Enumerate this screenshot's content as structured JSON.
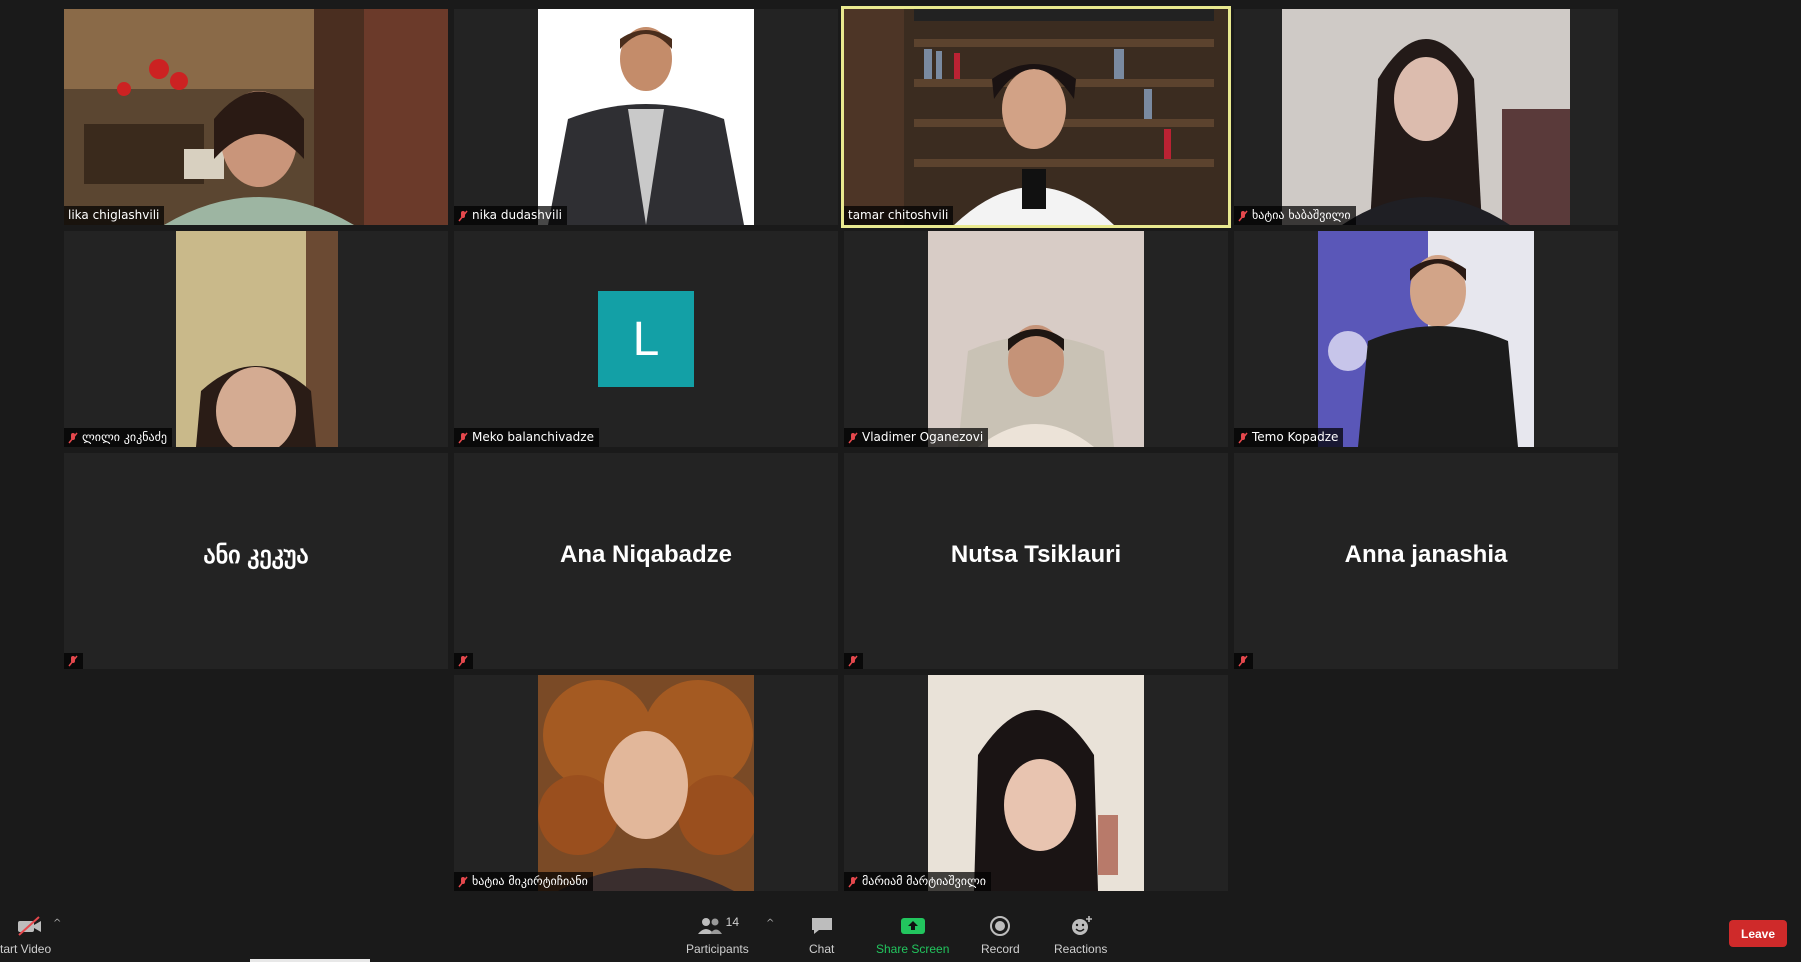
{
  "participants": [
    {
      "name": "lika chiglashvili",
      "muted": false,
      "active": false,
      "kind": "video",
      "scene": "living-room"
    },
    {
      "name": "nika dudashvili",
      "muted": true,
      "active": false,
      "kind": "photo",
      "scene": "suit-white"
    },
    {
      "name": "tamar chitoshvili",
      "muted": false,
      "active": true,
      "kind": "video",
      "scene": "bookshelf"
    },
    {
      "name": "ხატია ხაბაშვილი",
      "muted": true,
      "active": false,
      "kind": "photo",
      "scene": "dark-hair"
    },
    {
      "name": "ლილი კიკნაძე",
      "muted": true,
      "active": false,
      "kind": "photo",
      "scene": "wallpaper"
    },
    {
      "name": "Meko balanchivadze",
      "muted": true,
      "active": false,
      "kind": "avatar",
      "initial": "L"
    },
    {
      "name": "Vladimer Oganezovi",
      "muted": true,
      "active": false,
      "kind": "photo",
      "scene": "chair"
    },
    {
      "name": "Temo Kopadze",
      "muted": true,
      "active": false,
      "kind": "photo",
      "scene": "banner"
    },
    {
      "name": "",
      "big_name": "ანი კეკუა",
      "muted": true,
      "active": false,
      "kind": "name"
    },
    {
      "name": "",
      "big_name": "Ana Niqabadze",
      "muted": true,
      "active": false,
      "kind": "name"
    },
    {
      "name": "",
      "big_name": "Nutsa Tsiklauri",
      "muted": true,
      "active": false,
      "kind": "name"
    },
    {
      "name": "",
      "big_name": "Anna janashia",
      "muted": true,
      "active": false,
      "kind": "name"
    },
    {
      "name": "ხატია მიკირტიჩიანი",
      "muted": true,
      "active": false,
      "kind": "photo",
      "scene": "curly"
    },
    {
      "name": "მარიამ მარტიაშვილი",
      "muted": true,
      "active": false,
      "kind": "photo",
      "scene": "white-wall"
    }
  ],
  "toolbar": {
    "start_video_label": "tart Video",
    "participants_label": "Participants",
    "participants_count": "14",
    "chat_label": "Chat",
    "share_label": "Share Screen",
    "record_label": "Record",
    "reactions_label": "Reactions",
    "leave_label": "Leave"
  },
  "colors": {
    "background": "#1a1a1a",
    "tile": "#232323",
    "active_border": "#e9e98f",
    "share_green": "#22c55e",
    "leave_red": "#cf2a2a",
    "avatar_teal": "#13a0a6",
    "mute_red": "#e5484d"
  }
}
